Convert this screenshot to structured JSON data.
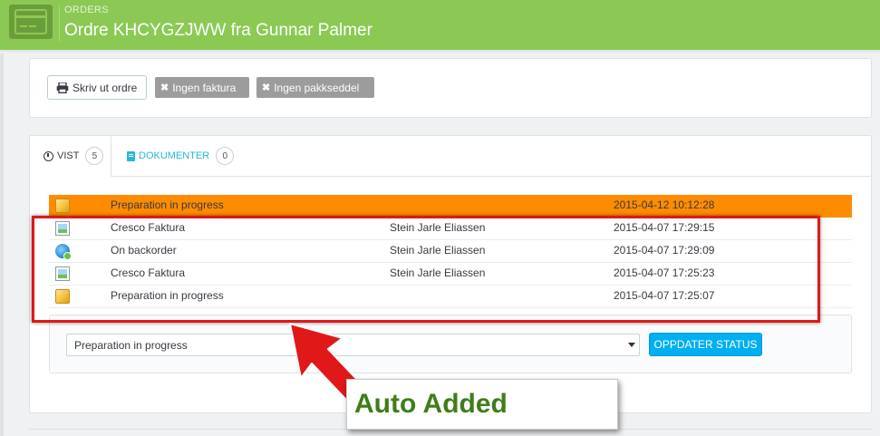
{
  "header": {
    "breadcrumb": "ORDERS",
    "title": "Ordre KHCYGZJWW fra Gunnar Palmer",
    "icon": "credit-card-icon",
    "color": "#8bc954"
  },
  "toolbar": {
    "print_label": "Skriv ut ordre",
    "no_invoice_label": "Ingen faktura",
    "no_slip_label": "Ingen pakkseddel"
  },
  "tabs": [
    {
      "label": "VIST",
      "count": "5",
      "icon": "clock-icon"
    },
    {
      "label": "DOKUMENTER",
      "count": "0",
      "icon": "document-icon"
    }
  ],
  "history": [
    {
      "icon": "package-icon",
      "status": "Preparation in progress",
      "employee": "",
      "date": "2015-04-12 10:12:28",
      "current": true
    },
    {
      "icon": "image-icon",
      "status": "Cresco Faktura",
      "employee": "Stein Jarle Eliassen",
      "date": "2015-04-07 17:29:15"
    },
    {
      "icon": "refresh-icon",
      "status": "On backorder",
      "employee": "Stein Jarle Eliassen",
      "date": "2015-04-07 17:29:09"
    },
    {
      "icon": "image-icon",
      "status": "Cresco Faktura",
      "employee": "Stein Jarle Eliassen",
      "date": "2015-04-07 17:25:23"
    },
    {
      "icon": "package-icon",
      "status": "Preparation in progress",
      "employee": "",
      "date": "2015-04-07 17:25:07"
    }
  ],
  "status_form": {
    "selected": "Preparation in progress",
    "button_label": "OPPDATER STATUS",
    "accent": "#00aff0"
  },
  "annotation": {
    "label": "Auto Added",
    "color": "#e01818",
    "text_color": "#3f7d19"
  },
  "current_row_color": "#ff8c00"
}
